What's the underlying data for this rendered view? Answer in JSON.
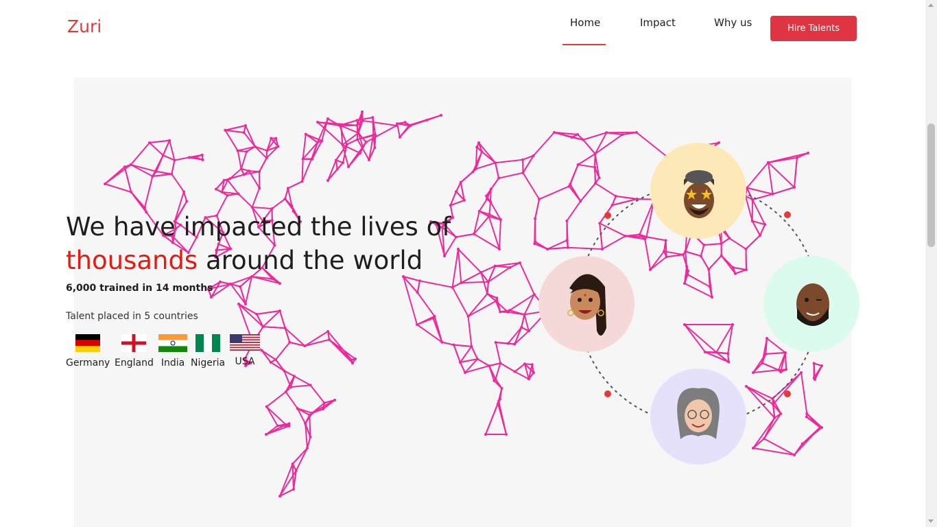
{
  "brand": {
    "logo": "Zuri",
    "accent": "#e53935",
    "button_color": "#df3542",
    "map_color": "#ee2a9b"
  },
  "nav": {
    "items": [
      {
        "label": "Home",
        "active": true
      },
      {
        "label": "Impact"
      },
      {
        "label": "Why us"
      }
    ],
    "cta": "Hire Talents"
  },
  "hero": {
    "headline_part1": "We have impacted the lives of",
    "headline_highlight": "thousands",
    "headline_part2": "around the world",
    "stat": "6,000 trained in 14 months",
    "placement": "Talent placed in 5 countries",
    "countries": [
      {
        "name": "Germany",
        "flag": "germany-flag-icon"
      },
      {
        "name": "England",
        "flag": "england-flag-icon"
      },
      {
        "name": "India",
        "flag": "india-flag-icon"
      },
      {
        "name": "Nigeria",
        "flag": "nigeria-flag-icon"
      },
      {
        "name": "USA",
        "flag": "usa-flag-icon"
      }
    ],
    "avatars": [
      {
        "name": "memoji-star-eyes-avatar",
        "bg": "#fde9b7"
      },
      {
        "name": "memoji-woman-braid-avatar",
        "bg": "#f5d9d9"
      },
      {
        "name": "memoji-winking-man-avatar",
        "bg": "#dcfbef"
      },
      {
        "name": "memoji-grey-hair-woman-avatar",
        "bg": "#e6e1fb"
      }
    ]
  }
}
